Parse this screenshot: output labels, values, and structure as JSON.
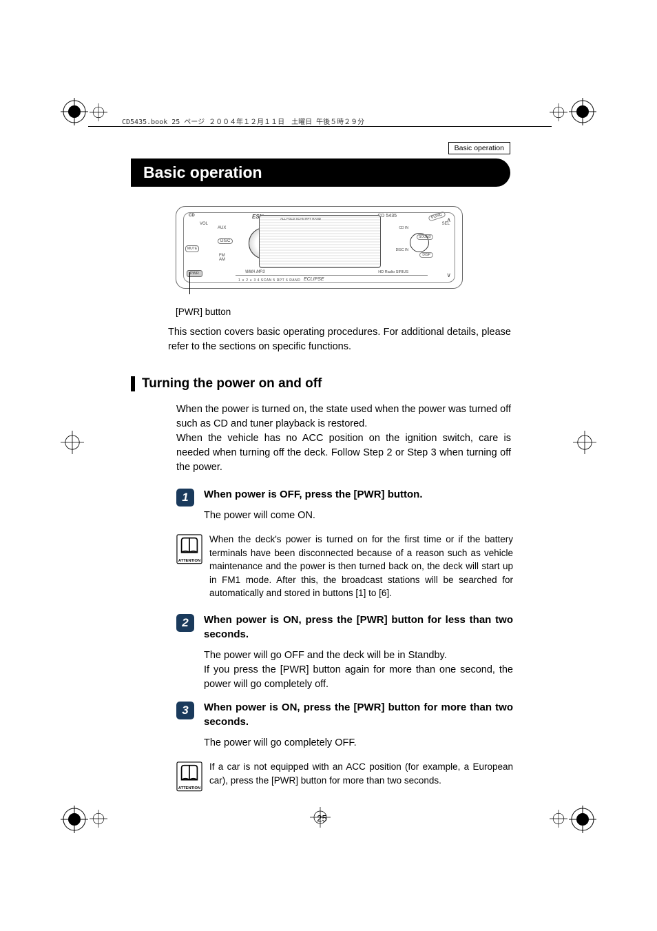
{
  "header": {
    "running": "CD5435.book  25 ページ  ２００４年１２月１１日　土曜日  午後５時２９分",
    "section_tab": "Basic operation"
  },
  "title": "Basic operation",
  "device": {
    "esn": "ESN",
    "model": "CD 5435",
    "labels": {
      "cd": "CD",
      "vol": "VOL",
      "aux": "AUX",
      "disc": "DISC",
      "mute": "MUTE",
      "fm_am": "FM\nAM",
      "pwr": "PWR",
      "func": "FUNC",
      "sel": "SEL",
      "sound": "SOUND",
      "disp": "DISP",
      "cdin": "CD IN",
      "discin": "DISC IN",
      "screen_top": "ALL  FOLD  SCAN  RPT  RAND",
      "eclipse": "ECLIPSE",
      "hdradio": "HD Radio   SIRIUS",
      "wma": "WMA  MP3",
      "buttons": "1    ∨    2    ∧    3                                  4  SCAN   5   RPT   6  RAND"
    }
  },
  "pwr_button_label": "[PWR] button",
  "intro": "This section covers basic operating procedures. For additional details, please refer to the sections on specific functions.",
  "subheading": "Turning the power on and off",
  "sub_intro_1": "When the power is turned on, the state used when the power was turned off such as CD and tuner playback is restored.",
  "sub_intro_2": "When the vehicle has no ACC position on the ignition switch, care is needed when turning off the deck. Follow Step 2 or Step 3 when turning off the power.",
  "steps": [
    {
      "num": "1",
      "title": "When power is OFF, press the [PWR] button.",
      "text": "The power will come ON."
    },
    {
      "num": "2",
      "title": "When power is ON, press the [PWR] button for less than two seconds.",
      "text": "The power will go OFF and the deck will be in Standby.\nIf you press the [PWR] button again for more than one second, the power will go completely off."
    },
    {
      "num": "3",
      "title": "When power is ON, press the [PWR] button for more than two seconds.",
      "text": "The power will go completely OFF."
    }
  ],
  "notes": [
    {
      "label": "ATTENTION",
      "text": "When the deck's power is turned on for the first time or if the battery terminals have been disconnected because of a reason such as vehicle maintenance and the power is then turned back on, the deck will start up in FM1 mode. After this, the broadcast stations will be searched for automatically and stored in buttons [1] to [6]."
    },
    {
      "label": "ATTENTION",
      "text": "If a car is not equipped with an ACC position (for example, a European car), press the [PWR] button for more than two seconds."
    }
  ],
  "page_number": "25"
}
